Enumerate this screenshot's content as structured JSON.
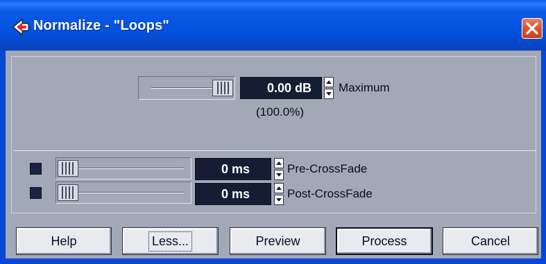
{
  "window": {
    "title": "Normalize - \"Loops\"",
    "close_icon": "close-x-icon",
    "app_icon": "cubase-logo-icon"
  },
  "maximum": {
    "value": "0.00 dB",
    "label": "Maximum",
    "percent": "(100.0%)",
    "slider_level": 1.0
  },
  "crossfades": [
    {
      "value": "0 ms",
      "label": "Pre-CrossFade",
      "checked": true,
      "slider_level": 0.0
    },
    {
      "value": "0 ms",
      "label": "Post-CrossFade",
      "checked": true,
      "slider_level": 0.0
    }
  ],
  "buttons": {
    "help": "Help",
    "less": "Less...",
    "preview": "Preview",
    "process": "Process",
    "cancel": "Cancel"
  },
  "colors": {
    "titlebar": "#0a52dc",
    "dialog_bg": "#a3a8b7",
    "value_field": "#141d34",
    "close_button": "#d9582f"
  }
}
